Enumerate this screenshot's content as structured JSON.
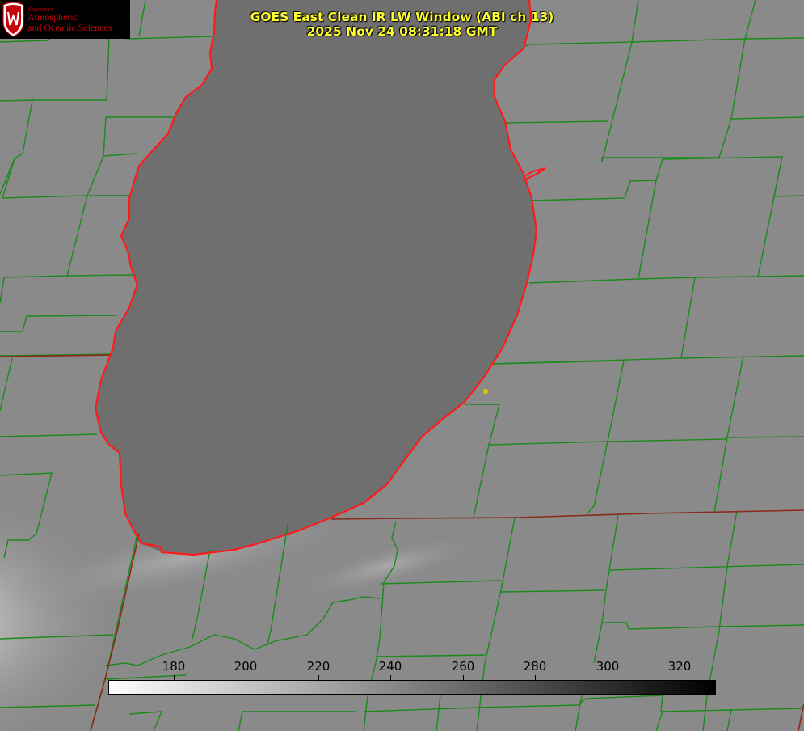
{
  "header": {
    "title_line1": "GOES East Clean IR LW Window (ABI ch 13)",
    "title_line2": "2025 Nov 24 08:31:18 GMT"
  },
  "logo": {
    "department": "Department of",
    "line1": "Atmospheric",
    "line2": "and Oceanic Sciences",
    "brand_color": "#c5050c"
  },
  "colorbar": {
    "ticks": [
      "180",
      "200",
      "220",
      "240",
      "260",
      "280",
      "300",
      "320"
    ],
    "start_color": "#ffffff",
    "end_color": "#000000"
  },
  "map": {
    "lake_fill": "#6f6f6f",
    "land_fill": "#8a8a8a",
    "county_line_color": "#1a8a1a",
    "shoreline_color": "#ff1a1a",
    "station_color": "#d8c800"
  }
}
